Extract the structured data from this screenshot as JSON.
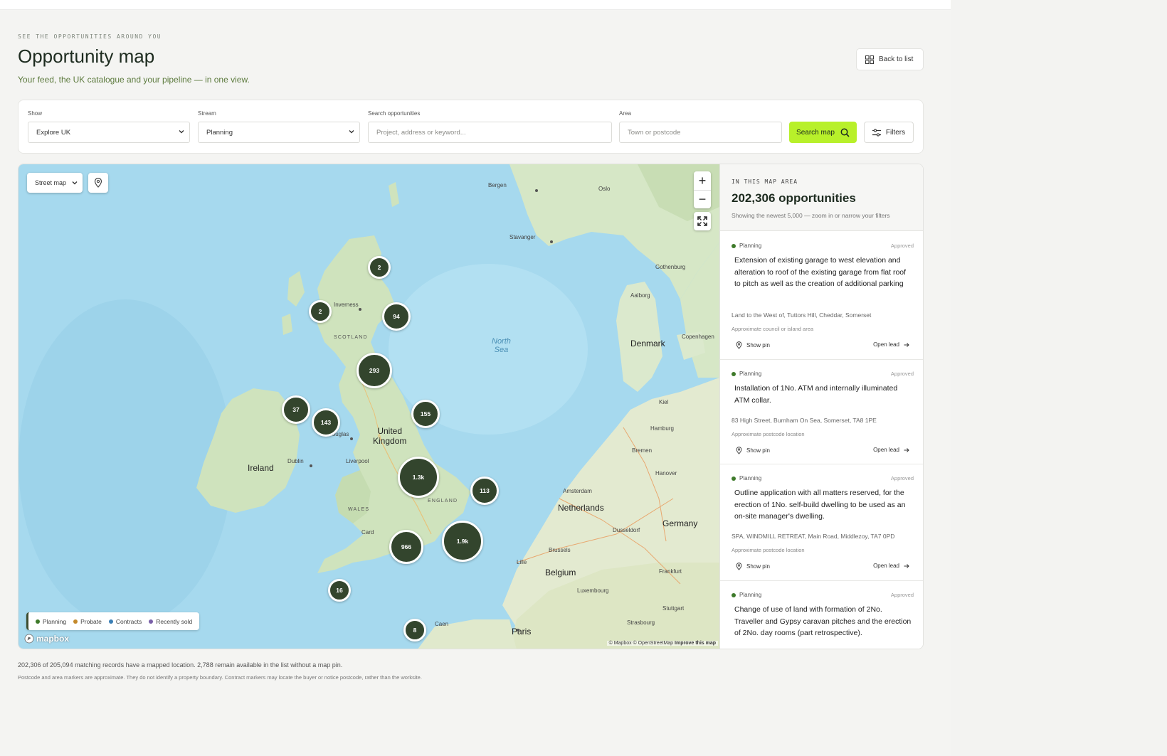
{
  "page": {
    "eyebrow": "SEE THE OPPORTUNITIES AROUND YOU",
    "title": "Opportunity map",
    "subtitle": "Your feed, the UK catalogue and your pipeline — in one view.",
    "back_label": "Back to list"
  },
  "filters": {
    "show": {
      "label": "Show",
      "value": "Explore UK"
    },
    "stream": {
      "label": "Stream",
      "value": "Planning"
    },
    "search": {
      "label": "Search opportunities",
      "placeholder": "Project, address or keyword..."
    },
    "area": {
      "label": "Area",
      "placeholder": "Town or postcode"
    },
    "search_button": "Search map",
    "filters_button": "Filters"
  },
  "map": {
    "map_type": "Street map",
    "zoom_in": "+",
    "zoom_out": "−",
    "legend": [
      {
        "label": "Planning",
        "color": "#3e7a2a"
      },
      {
        "label": "Probate",
        "color": "#c4892b"
      },
      {
        "label": "Contracts",
        "color": "#3b7fb5"
      },
      {
        "label": "Recently sold",
        "color": "#7a5fa8"
      }
    ],
    "logo": "mapbox",
    "attribution_prefix": "© Mapbox © OpenStreetMap",
    "attribution_link": "Improve this map",
    "clusters": [
      {
        "label": "2"
      },
      {
        "label": "2"
      },
      {
        "label": "94"
      },
      {
        "label": "293"
      },
      {
        "label": "37"
      },
      {
        "label": "143"
      },
      {
        "label": "155"
      },
      {
        "label": "1.3k"
      },
      {
        "label": "113"
      },
      {
        "label": "1.9k"
      },
      {
        "label": "966"
      },
      {
        "label": "16"
      },
      {
        "label": "8"
      }
    ],
    "labels": {
      "bergen": "Bergen",
      "oslo": "Oslo",
      "stavanger": "Stavanger",
      "gothenburg": "Gothenburg",
      "aalborg": "Aalborg",
      "denmark": "Denmark",
      "copenhagen": "Copenhagen",
      "kiel": "Kiel",
      "hamburg": "Hamburg",
      "bremen": "Bremen",
      "hanover": "Hanover",
      "amsterdam": "Amsterdam",
      "netherlands": "Netherlands",
      "germany": "Germany",
      "dusseldorf": "Dusseldorf",
      "brussels": "Brussels",
      "belgium": "Belgium",
      "frankfurt": "Frankfurt",
      "luxembourg": "Luxembourg",
      "stuttgart": "Stuttgart",
      "strasbourg": "Strasbourg",
      "lille": "Lille",
      "paris": "Paris",
      "caen": "Caen",
      "north_sea_1": "North",
      "north_sea_2": "Sea",
      "inverness": "Inverness",
      "scotland": "SCOTLAND",
      "uk_1": "United",
      "uk_2": "Kingdom",
      "douglas": "Douglas",
      "ireland": "Ireland",
      "dublin": "Dublin",
      "liverpool": "Liverpool",
      "wales": "WALES",
      "england": "ENGLAND",
      "cardiff": "Card"
    }
  },
  "panel": {
    "eyebrow": "IN THIS MAP AREA",
    "count": "202,306 opportunities",
    "note": "Showing the newest 5,000 — zoom in or narrow your filters",
    "show_pin": "Show pin",
    "open_lead": "Open lead",
    "items": [
      {
        "stream": "Planning",
        "status": "Approved",
        "description": "Extension of existing garage to west elevation and alteration to roof of the existing garage from flat roof to pitch as well as the creation of additional parking",
        "address": "Land to the West of, Tuttors Hill, Cheddar, Somerset",
        "location_note": "Approximate council or island area"
      },
      {
        "stream": "Planning",
        "status": "Approved",
        "description": "Installation of 1No. ATM and internally illuminated ATM collar.",
        "address": "83 High Street, Burnham On Sea, Somerset, TA8 1PE",
        "location_note": "Approximate postcode location"
      },
      {
        "stream": "Planning",
        "status": "Approved",
        "description": "Outline application with all matters reserved, for the erection of 1No. self-build dwelling to be used as an on-site manager's dwelling.",
        "address": "SPA, WINDMILL RETREAT, Main Road, Middlezoy, TA7 0PD",
        "location_note": "Approximate postcode location"
      },
      {
        "stream": "Planning",
        "status": "Approved",
        "description": "Change of use of land with formation of 2No. Traveller and Gypsy caravan pitches and the erection of 2No. day rooms (part retrospective)."
      }
    ]
  },
  "footer": {
    "line1": "202,306 of 205,094 matching records have a mapped location. 2,788 remain available in the list without a map pin.",
    "line2": "Postcode and area markers are approximate. They do not identify a property boundary. Contract markers may locate the buyer or notice postcode, rather than the worksite."
  }
}
